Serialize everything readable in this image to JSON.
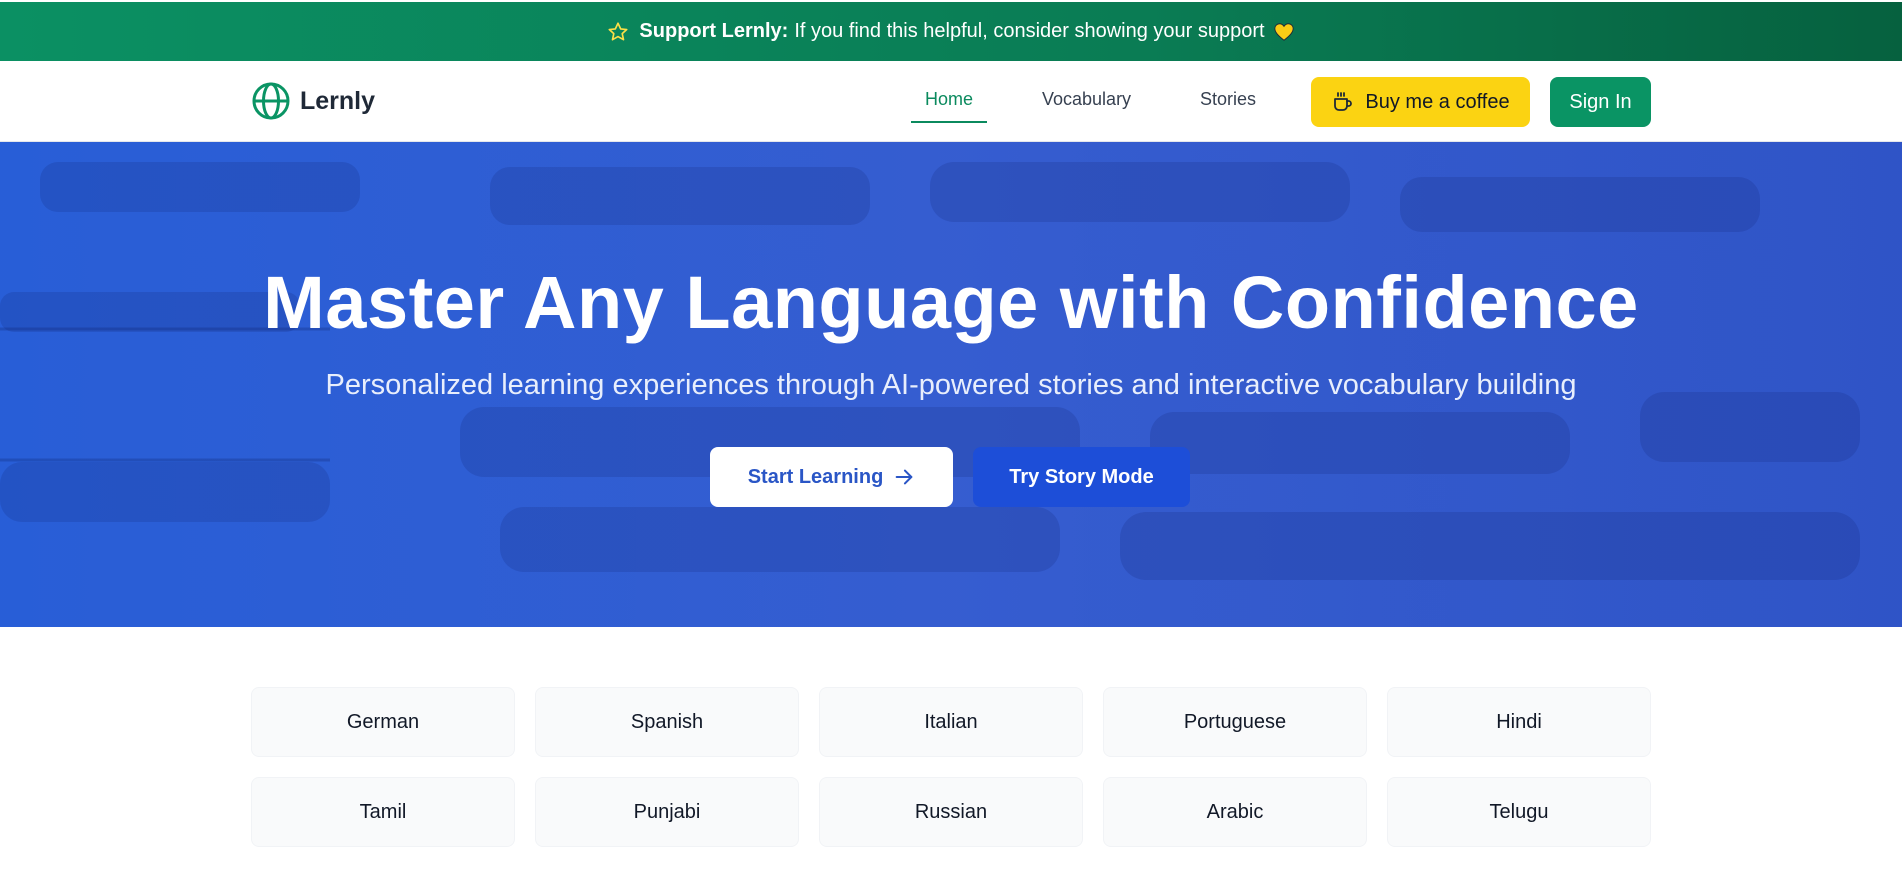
{
  "banner": {
    "bold": "Support Lernly:",
    "text": "If you find this helpful, consider showing your support",
    "icons": [
      "star-icon",
      "heart-icon"
    ]
  },
  "nav": {
    "logo": "Lernly",
    "links": [
      {
        "label": "Home",
        "active": true
      },
      {
        "label": "Vocabulary",
        "active": false
      },
      {
        "label": "Stories",
        "active": false
      }
    ],
    "coffee_label": "Buy me a coffee",
    "signin_label": "Sign In"
  },
  "hero": {
    "title": "Master Any Language with Confidence",
    "subtitle": "Personalized learning experiences through AI-powered stories and interactive vocabulary building",
    "start_label": "Start Learning",
    "story_label": "Try Story Mode"
  },
  "languages": [
    "German",
    "Spanish",
    "Italian",
    "Portuguese",
    "Hindi",
    "Tamil",
    "Punjabi",
    "Russian",
    "Arabic",
    "Telugu"
  ],
  "colors": {
    "brand_green": "#0a9464",
    "coffee_yellow": "#fbd312",
    "hero_blue": "#3a60d2",
    "story_blue": "#1d4ed8"
  }
}
